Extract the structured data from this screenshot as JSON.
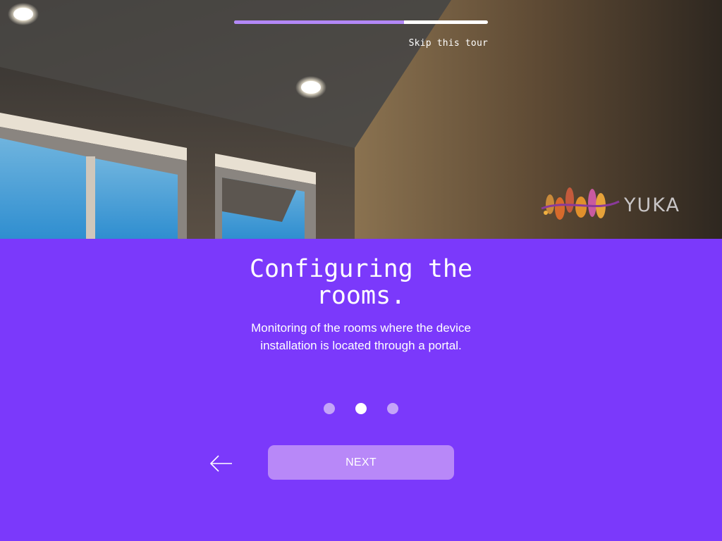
{
  "tour": {
    "progress_fraction": 0.67,
    "skip_label": "Skip this tour",
    "brand_name": "YUKA",
    "slide": {
      "title": "Configuring the rooms.",
      "description": "Monitoring of the rooms where the device installation is located through a portal."
    },
    "pagination": {
      "total": 3,
      "active_index": 1
    },
    "back_icon": "arrow-left-icon",
    "next_label": "NEXT"
  },
  "colors": {
    "background": "#7b39fb",
    "progress_fill": "#b388f7",
    "progress_track": "#ffffff",
    "button": "#b888f8",
    "dot_inactive": "#c4a4f8",
    "dot_active": "#ffffff"
  }
}
